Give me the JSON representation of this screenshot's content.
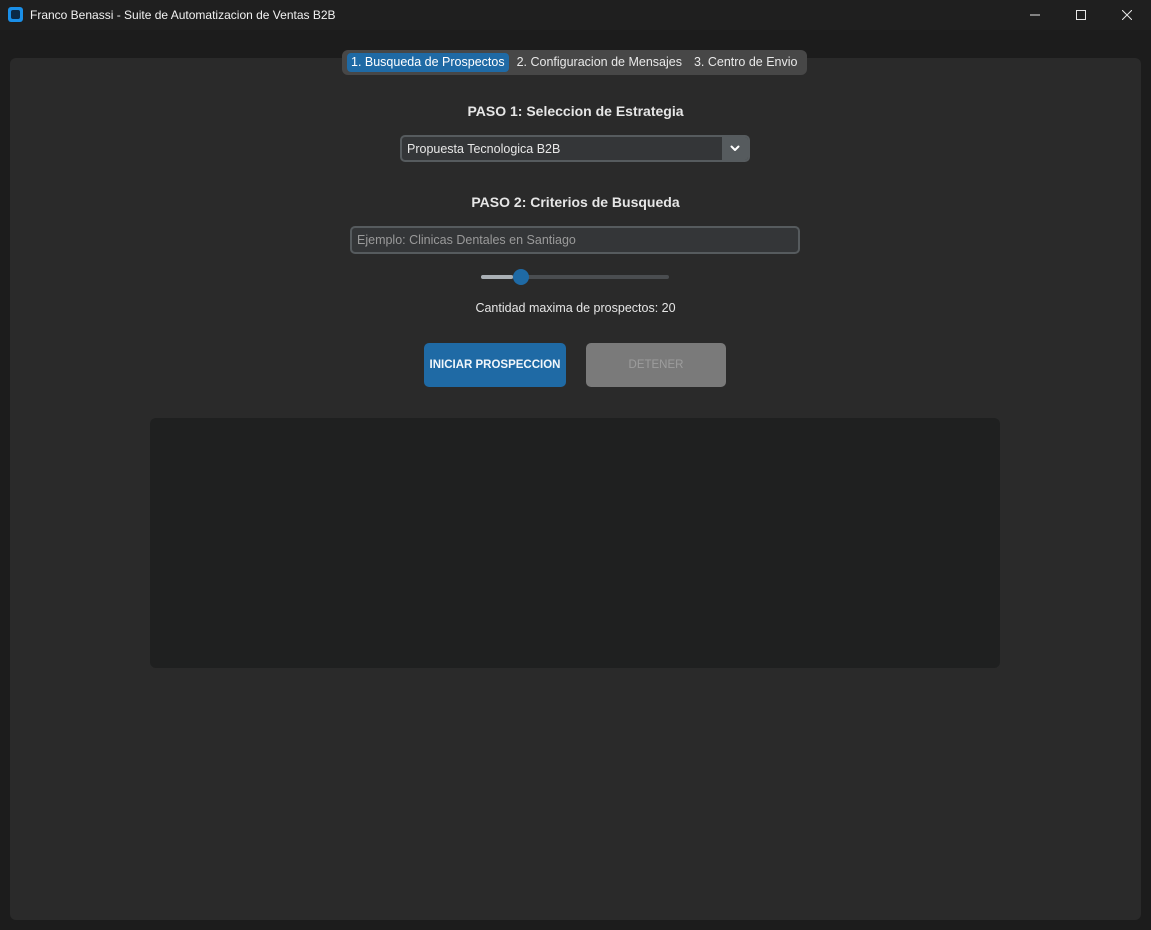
{
  "window": {
    "title": "Franco Benassi - Suite de Automatizacion de Ventas B2B"
  },
  "tabs": [
    {
      "label": "1. Busqueda de Prospectos",
      "active": true
    },
    {
      "label": "2. Configuracion de Mensajes",
      "active": false
    },
    {
      "label": "3. Centro de Envio",
      "active": false
    }
  ],
  "step1": {
    "title": "PASO 1: Seleccion de Estrategia",
    "strategy_selected": "Propuesta Tecnologica B2B"
  },
  "step2": {
    "title": "PASO 2: Criterios de Busqueda",
    "search_placeholder": "Ejemplo: Clinicas Dentales en Santiago",
    "search_value": "",
    "slider_fraction": 0.17,
    "max_label": "Cantidad maxima de prospectos: 20"
  },
  "actions": {
    "start_label": "INICIAR PROSPECCION",
    "stop_label": "DETENER"
  },
  "colors": {
    "accent": "#1f6aa5",
    "panel": "#2a2a2a",
    "log_bg": "#1f2020"
  }
}
